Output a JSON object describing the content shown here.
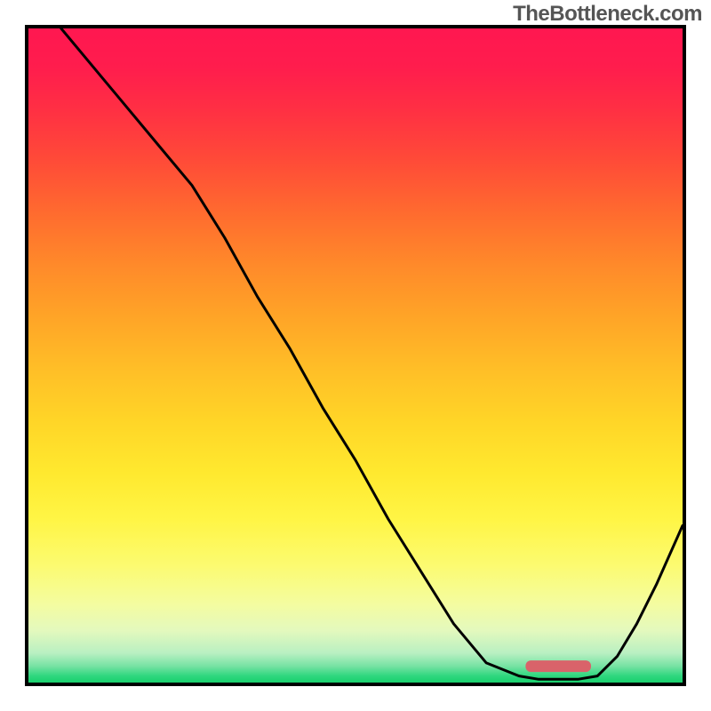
{
  "watermark": "TheBottleneck.com",
  "chart_data": {
    "type": "line",
    "title": "",
    "xlabel": "",
    "ylabel": "",
    "xlim": [
      0,
      100
    ],
    "ylim": [
      0,
      100
    ],
    "series": [
      {
        "name": "bottleneck-curve",
        "x": [
          5,
          10,
          15,
          20,
          25,
          30,
          35,
          40,
          45,
          50,
          55,
          60,
          65,
          70,
          75,
          78,
          81,
          84,
          87,
          90,
          93,
          96,
          100
        ],
        "y": [
          100,
          94,
          88,
          82,
          76,
          68,
          59,
          51,
          42,
          34,
          25,
          17,
          9,
          3,
          1,
          0.5,
          0.5,
          0.5,
          1,
          4,
          9,
          15,
          24
        ]
      }
    ],
    "highlight_segment": {
      "x_start": 76,
      "x_end": 86,
      "y": 2.5
    },
    "background_gradient_stops": [
      {
        "offset": 0.0,
        "color": "#ff1750"
      },
      {
        "offset": 0.06,
        "color": "#ff1d4d"
      },
      {
        "offset": 0.12,
        "color": "#ff2e44"
      },
      {
        "offset": 0.2,
        "color": "#ff4a38"
      },
      {
        "offset": 0.28,
        "color": "#ff6a2f"
      },
      {
        "offset": 0.36,
        "color": "#ff892a"
      },
      {
        "offset": 0.44,
        "color": "#ffa427"
      },
      {
        "offset": 0.52,
        "color": "#ffbe27"
      },
      {
        "offset": 0.6,
        "color": "#ffd527"
      },
      {
        "offset": 0.68,
        "color": "#ffe92f"
      },
      {
        "offset": 0.75,
        "color": "#fff545"
      },
      {
        "offset": 0.82,
        "color": "#fcfb70"
      },
      {
        "offset": 0.88,
        "color": "#f4fca0"
      },
      {
        "offset": 0.92,
        "color": "#e4f9bd"
      },
      {
        "offset": 0.955,
        "color": "#b9f0c2"
      },
      {
        "offset": 0.975,
        "color": "#76e2a3"
      },
      {
        "offset": 0.99,
        "color": "#2ed77e"
      },
      {
        "offset": 1.0,
        "color": "#19d06d"
      }
    ],
    "highlight_color": "#d9636a"
  }
}
